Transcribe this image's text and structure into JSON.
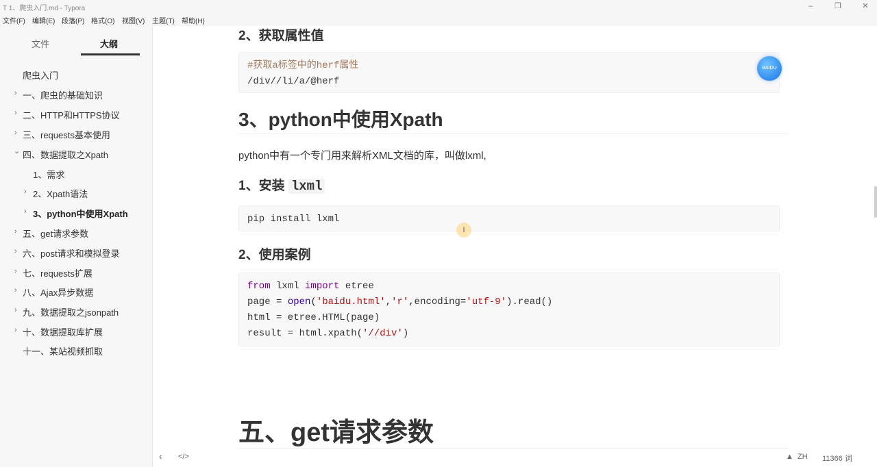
{
  "window": {
    "title": "1、爬虫入门.md - Typora",
    "app_icon": "T"
  },
  "menu": [
    "文件(F)",
    "编辑(E)",
    "段落(P)",
    "格式(O)",
    "视图(V)",
    "主题(T)",
    "帮助(H)"
  ],
  "sidebar": {
    "tabs": {
      "files": "文件",
      "outline": "大纲"
    },
    "items": [
      {
        "label": "爬虫入门",
        "caret": ""
      },
      {
        "label": "一、爬虫的基础知识",
        "caret": "›"
      },
      {
        "label": "二、HTTP和HTTPS协议",
        "caret": "›"
      },
      {
        "label": "三、requests基本使用",
        "caret": "›"
      },
      {
        "label": "四、数据提取之Xpath",
        "caret": "⌄"
      },
      {
        "label": "1、需求",
        "caret": ""
      },
      {
        "label": "2、Xpath语法",
        "caret": "›"
      },
      {
        "label": "3、python中使用Xpath",
        "caret": "›"
      },
      {
        "label": "五、get请求参数",
        "caret": "›"
      },
      {
        "label": "六、post请求和模拟登录",
        "caret": "›"
      },
      {
        "label": "七、requests扩展",
        "caret": "›"
      },
      {
        "label": "八、Ajax异步数据",
        "caret": "›"
      },
      {
        "label": "九、数据提取之jsonpath",
        "caret": "›"
      },
      {
        "label": "十、数据提取库扩展",
        "caret": "›"
      },
      {
        "label": "十一、某站视频抓取",
        "caret": ""
      }
    ]
  },
  "editor": {
    "h_attr": "2、获取属性值",
    "code1": {
      "comment": "#获取a标签中的herf属性",
      "line2": "/div//li/a/@herf"
    },
    "h_xpath": "3、python中使用Xpath",
    "para": "python中有一个专门用来解析XML文档的库，叫做lxml,",
    "h_install": "1、安装",
    "h_install_code": "lxml",
    "code2": "pip install lxml",
    "h_case": "2、使用案例",
    "code3": {
      "l1_kw1": "from",
      "l1_mod": " lxml ",
      "l1_kw2": "import",
      "l1_rest": " etree",
      "l2_a": "page = ",
      "l2_fn": "open",
      "l2_b": "(",
      "l2_s1": "'baidu.html'",
      "l2_c": ",",
      "l2_s2": "'r'",
      "l2_d": ",encoding=",
      "l2_s3": "'utf-9'",
      "l2_e": ").read()",
      "l3": "html = etree.HTML(page)",
      "l4_a": "result = html.xpath(",
      "l4_s": "'//div'",
      "l4_b": ")"
    },
    "h_get": "五、get请求参数",
    "badge_text": "BAIDU"
  },
  "status": {
    "lang": "ZH",
    "words": "11366 词"
  },
  "colors": {
    "comment": "#a0785a",
    "keyword": "#770088",
    "string": "#aa1111",
    "builtin": "#3300aa"
  }
}
